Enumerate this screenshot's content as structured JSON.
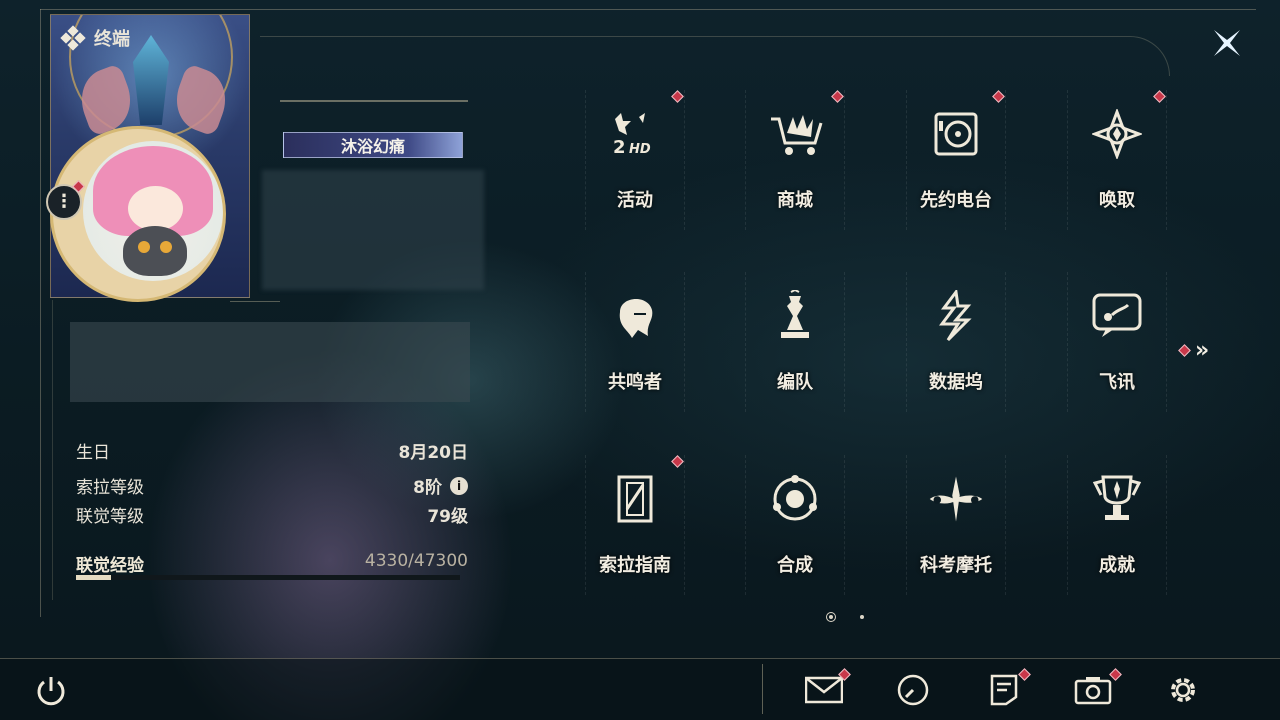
{
  "header": {
    "title": "终端"
  },
  "profile": {
    "title_badge": "沐浴幻痛",
    "birthday_label": "生日",
    "birthday_value": "8月20日",
    "sola_level_label": "索拉等级",
    "sola_level_value": "8阶",
    "union_level_label": "联觉等级",
    "union_level_value": "79级",
    "union_exp_label": "联觉经验",
    "union_exp_value": "4330/47300",
    "union_exp_fraction": 0.0915
  },
  "grid": {
    "items": [
      {
        "label": "活动",
        "icon": "activity-2hd-icon",
        "badge": true
      },
      {
        "label": "商城",
        "icon": "shop-cart-icon",
        "badge": true
      },
      {
        "label": "先约电台",
        "icon": "radio-icon",
        "badge": true
      },
      {
        "label": "唤取",
        "icon": "convene-icon",
        "badge": true
      },
      {
        "label": "共鸣者",
        "icon": "resonator-icon",
        "badge": false
      },
      {
        "label": "编队",
        "icon": "team-chess-icon",
        "badge": false
      },
      {
        "label": "数据坞",
        "icon": "data-bank-icon",
        "badge": false
      },
      {
        "label": "飞讯",
        "icon": "message-icon",
        "badge": false
      },
      {
        "label": "索拉指南",
        "icon": "guide-book-icon",
        "badge": true
      },
      {
        "label": "合成",
        "icon": "synthesis-icon",
        "badge": false
      },
      {
        "label": "科考摩托",
        "icon": "motorbike-icon",
        "badge": false
      },
      {
        "label": "成就",
        "icon": "trophy-icon",
        "badge": false
      }
    ]
  },
  "pagination": {
    "current": 1,
    "total": 2
  },
  "colors": {
    "badge_red": "#c8384a",
    "text": "#f2ede2",
    "background": "#0c1b22"
  }
}
